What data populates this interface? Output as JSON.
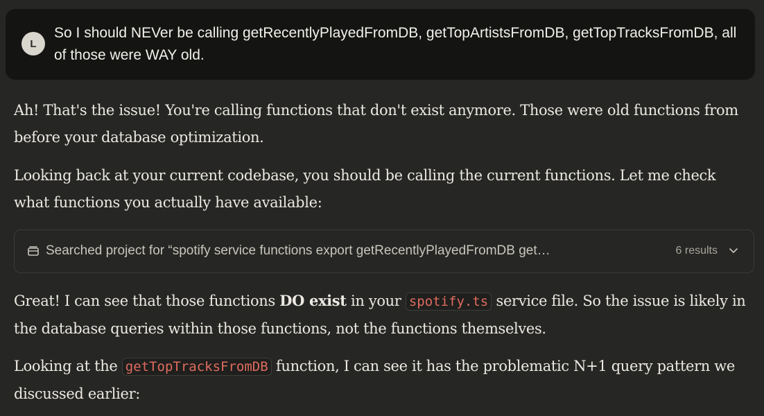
{
  "user_message": {
    "avatar_initial": "L",
    "text": "So I should NEVer be calling getRecentlyPlayedFromDB, getTopArtistsFromDB, getTopTracksFromDB, all of those were WAY old."
  },
  "assistant": {
    "p1": "Ah! That's the issue! You're calling functions that don't exist anymore. Those were old functions from before your database optimization.",
    "p2": "Looking back at your current codebase, you should be calling the current functions. Let me check what functions you actually have available:",
    "tool": {
      "icon": "search-folder-icon",
      "label": "Searched project for “spotify service functions export getRecentlyPlayedFromDB get…",
      "results": "6 results",
      "chevron": "chevron-down-icon"
    },
    "p3": {
      "before": "Great! I can see that those functions ",
      "bold": "DO exist",
      "middle": " in your ",
      "code": "spotify.ts",
      "after": " service file. So the issue is likely in the database queries within those functions, not the functions themselves."
    },
    "p4": {
      "before": "Looking at the ",
      "code": "getTopTracksFromDB",
      "after": " function, I can see it has the problematic N+1 query pattern we discussed earlier:"
    }
  },
  "colors": {
    "background": "#262624",
    "user_bubble": "#141413",
    "inline_code": "#e06c5e"
  }
}
